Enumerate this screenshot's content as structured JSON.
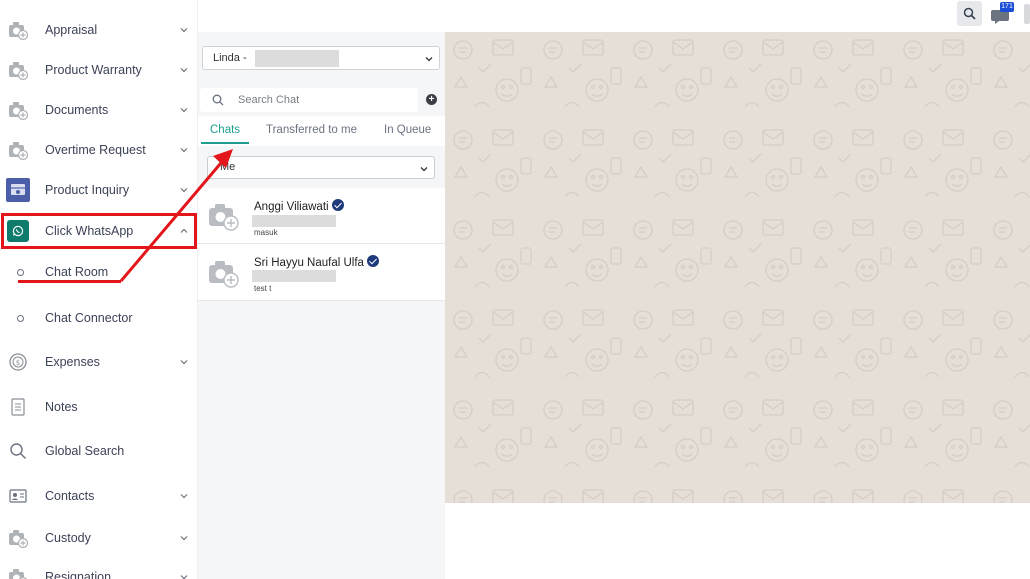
{
  "sidebar": {
    "items": [
      {
        "label": "Appraisal",
        "icon": "camera-icon",
        "has_chevron": true
      },
      {
        "label": "Product Warranty",
        "icon": "camera-icon",
        "has_chevron": true
      },
      {
        "label": "Documents",
        "icon": "camera-icon",
        "has_chevron": true
      },
      {
        "label": "Overtime Request",
        "icon": "camera-icon",
        "has_chevron": true
      },
      {
        "label": "Product Inquiry",
        "icon": "product-inquiry-icon",
        "has_chevron": true
      },
      {
        "label": "Click WhatsApp",
        "icon": "whatsapp-icon",
        "has_chevron": true,
        "expanded": true
      },
      {
        "label": "Chat Room",
        "icon": "circle-icon",
        "sub": true
      },
      {
        "label": "Chat Connector",
        "icon": "circle-icon",
        "sub": true
      },
      {
        "label": "Expenses",
        "icon": "coin-icon",
        "has_chevron": true
      },
      {
        "label": "Notes",
        "icon": "notes-icon",
        "has_chevron": false
      },
      {
        "label": "Global Search",
        "icon": "search-icon",
        "has_chevron": false
      },
      {
        "label": "Contacts",
        "icon": "contact-card-icon",
        "has_chevron": true
      },
      {
        "label": "Custody",
        "icon": "camera-icon",
        "has_chevron": true
      },
      {
        "label": "Resignation",
        "icon": "camera-icon",
        "has_chevron": true
      }
    ]
  },
  "topbar": {
    "notification_count": "171"
  },
  "chat_panel": {
    "agent_select_value": "Linda -",
    "search_placeholder": "Search Chat",
    "add_label": "+",
    "tabs": [
      {
        "label": "Chats",
        "active": true
      },
      {
        "label": "Transferred to me",
        "active": false
      },
      {
        "label": "In Queue",
        "active": false
      }
    ],
    "filter_value": "Me",
    "chats": [
      {
        "name": "Anggi Viliawati",
        "preview": "masuk",
        "verified": true
      },
      {
        "name": "Sri Hayyu Naufal Ulfa",
        "preview": "test t",
        "verified": true
      }
    ]
  },
  "colors": {
    "accent": "#1f9e8f",
    "whatsapp_badge": "#0f7b6c",
    "annotation_red": "#e3161b",
    "verified_badge": "#1e3a7b",
    "chat_background": "#e6dfd8"
  }
}
